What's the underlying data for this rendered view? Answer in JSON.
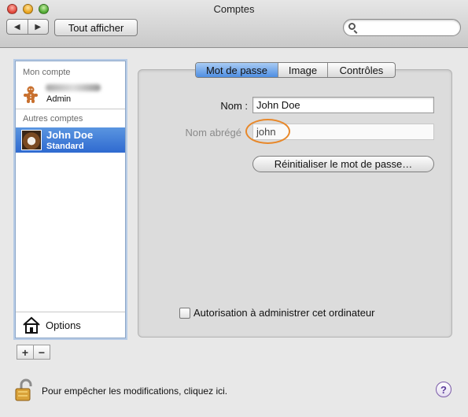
{
  "window": {
    "title": "Comptes"
  },
  "toolbar": {
    "back_icon": "left-arrow-icon",
    "forward_icon": "right-arrow-icon",
    "show_all_label": "Tout afficher",
    "search": {
      "value": "",
      "placeholder": ""
    }
  },
  "sidebar": {
    "my_account_header": "Mon compte",
    "my_account": {
      "type": "Admin"
    },
    "other_accounts_header": "Autres comptes",
    "other_accounts": [
      {
        "name": "John Doe",
        "type": "Standard",
        "selected": true
      }
    ],
    "options_label": "Options",
    "add_label": "+",
    "remove_label": "−"
  },
  "tabs": [
    {
      "label": "Mot de passe",
      "active": true
    },
    {
      "label": "Image",
      "active": false
    },
    {
      "label": "Contrôles",
      "active": false
    }
  ],
  "form": {
    "name_label": "Nom :",
    "name_value": "John Doe",
    "short_name_label": "Nom abrégé",
    "short_name_value": "john",
    "reset_password_label": "Réinitialiser le mot de passe…",
    "admin_checkbox_label": "Autorisation à administrer cet ordinateur",
    "admin_checked": false
  },
  "footer": {
    "lock_text": "Pour empêcher les modifications, cliquez ici.",
    "help_label": "?"
  },
  "colors": {
    "selection": "#3a76d6",
    "highlight_ring": "#e8882a"
  }
}
